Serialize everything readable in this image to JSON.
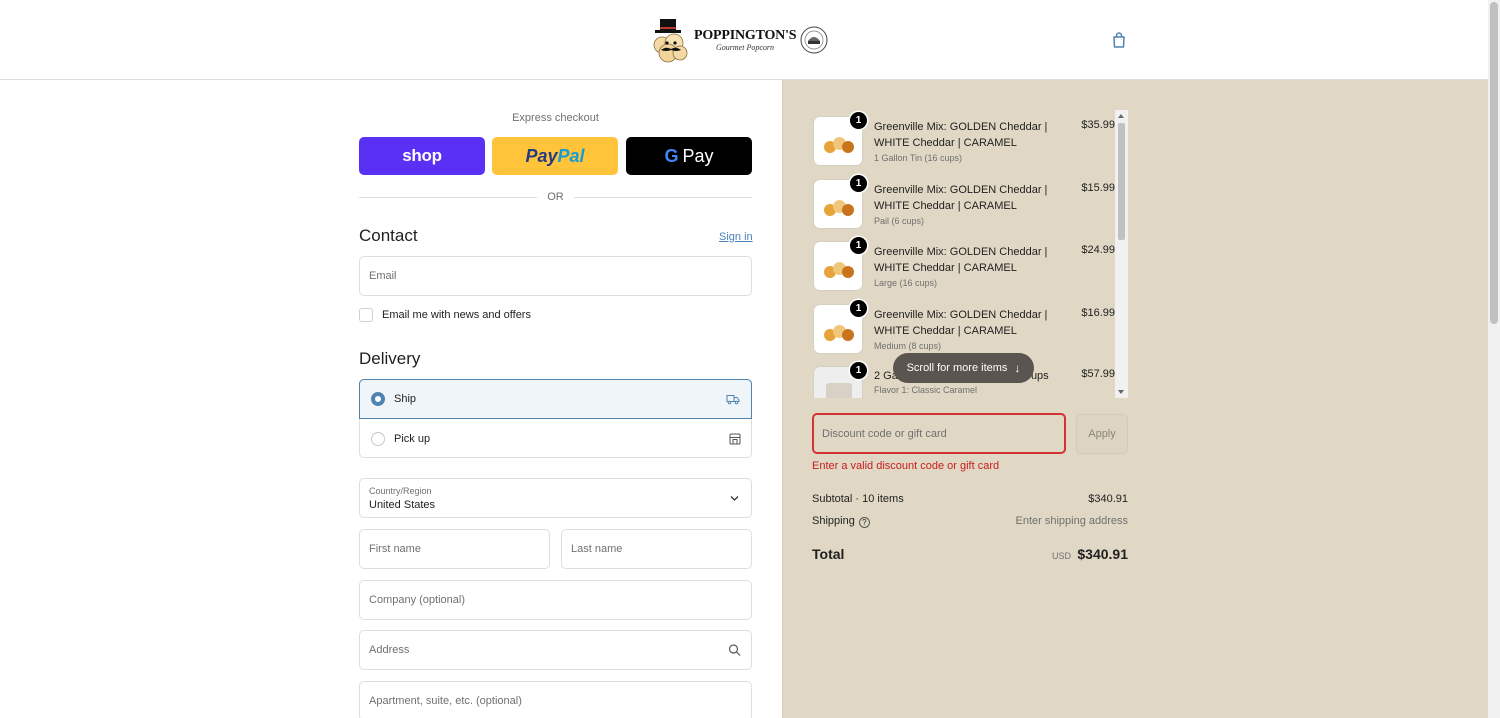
{
  "header": {
    "logo_name": "POPPINGTON'S",
    "logo_sub": "Gourmet Popcorn",
    "logo_seal_icon": "greenville-seal-icon",
    "cart_icon": "shopping-bag-icon"
  },
  "express": {
    "label": "Express checkout",
    "shop_label": "shop",
    "paypal_part1": "Pay",
    "paypal_part2": "Pal",
    "gpay_g": "G",
    "gpay_label": "Pay",
    "or": "OR"
  },
  "contact": {
    "title": "Contact",
    "sign_in": "Sign in",
    "email_placeholder": "Email",
    "newsletter_label": "Email me with news and offers"
  },
  "delivery": {
    "title": "Delivery",
    "ship_label": "Ship",
    "pickup_label": "Pick up",
    "ship_icon": "truck-icon",
    "pickup_icon": "store-icon",
    "country_label": "Country/Region",
    "country_value": "United States",
    "first_name_placeholder": "First name",
    "last_name_placeholder": "Last name",
    "company_placeholder": "Company (optional)",
    "address_placeholder": "Address",
    "apartment_placeholder": "Apartment, suite, etc. (optional)"
  },
  "order": {
    "items": [
      {
        "qty": "1",
        "name": "Greenville Mix: GOLDEN Cheddar | WHITE Cheddar | CARAMEL",
        "variant": "1 Gallon Tin (16 cups)",
        "price": "$35.99"
      },
      {
        "qty": "1",
        "name": "Greenville Mix: GOLDEN Cheddar | WHITE Cheddar | CARAMEL",
        "variant": "Pail (6 cups)",
        "price": "$15.99"
      },
      {
        "qty": "1",
        "name": "Greenville Mix: GOLDEN Cheddar | WHITE Cheddar | CARAMEL",
        "variant": "Large (16 cups)",
        "price": "$24.99"
      },
      {
        "qty": "1",
        "name": "Greenville Mix: GOLDEN Cheddar | WHITE Cheddar | CARAMEL",
        "variant": "Medium (8 cups)",
        "price": "$16.99"
      },
      {
        "qty": "1",
        "name": "2 Ga",
        "name_tail": "Cups",
        "variant": "Flavor 1: Classic Caramel",
        "price": "$57.99"
      }
    ],
    "scroll_hint": "Scroll for more items",
    "scroll_arrow": "↓"
  },
  "discount": {
    "placeholder": "Discount code or gift card",
    "apply": "Apply",
    "error": "Enter a valid discount code or gift card"
  },
  "summary": {
    "subtotal_label": "Subtotal · 10 items",
    "subtotal_value": "$340.91",
    "shipping_label": "Shipping",
    "shipping_value": "Enter shipping address",
    "total_label": "Total",
    "currency": "USD",
    "total_value": "$340.91"
  },
  "colors": {
    "accent": "#4f83b0",
    "shop_purple": "#5a31f4",
    "paypal_yellow": "#ffc439",
    "summary_bg": "#e0d8c5",
    "error_red": "#d33232"
  }
}
